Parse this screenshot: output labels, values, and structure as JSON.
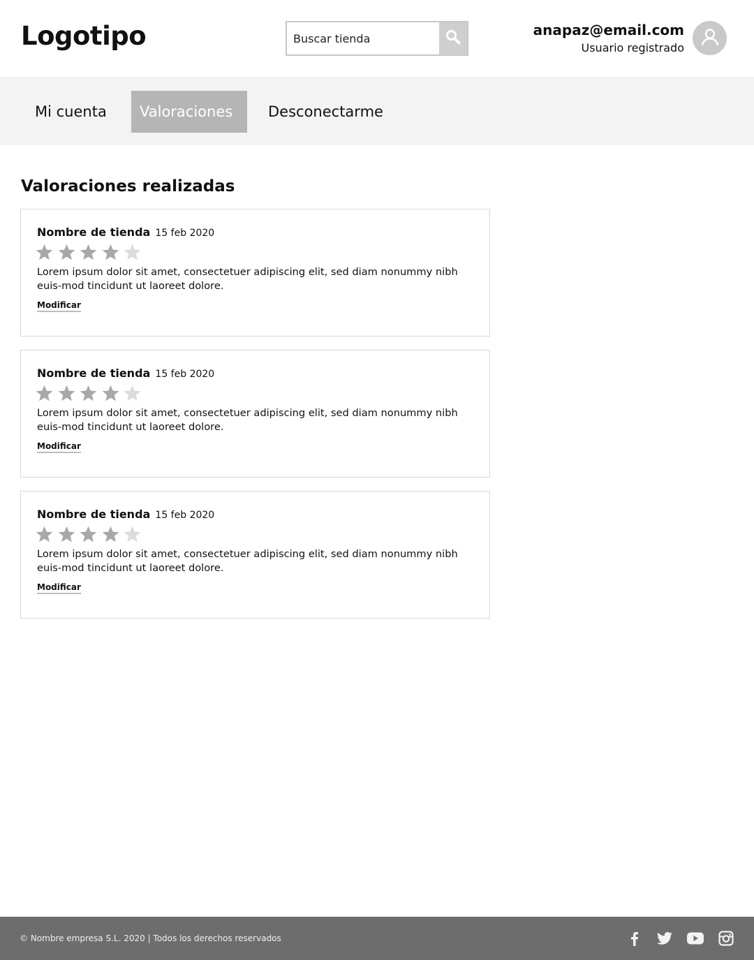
{
  "header": {
    "logo": "Logotipo",
    "search": {
      "placeholder": "Buscar tienda",
      "value": ""
    },
    "user": {
      "email": "anapaz@email.com",
      "role": "Usuario registrado"
    }
  },
  "nav": {
    "items": [
      {
        "label": "Mi cuenta",
        "active": false
      },
      {
        "label": "Valoraciones",
        "active": true
      },
      {
        "label": "Desconectarme",
        "active": false
      }
    ]
  },
  "main": {
    "title": "Valoraciones realizadas",
    "reviews": [
      {
        "store": "Nombre de tienda",
        "date": "15 feb 2020",
        "rating": 4,
        "max_rating": 5,
        "text": "Lorem ipsum dolor sit amet, consectetuer adipiscing elit, sed diam nonummy nibh euis-mod tincidunt ut laoreet dolore.",
        "action": "Modificar"
      },
      {
        "store": "Nombre de tienda",
        "date": "15 feb 2020",
        "rating": 4,
        "max_rating": 5,
        "text": "Lorem ipsum dolor sit amet, consectetuer adipiscing elit, sed diam nonummy nibh euis-mod tincidunt ut laoreet dolore.",
        "action": "Modificar"
      },
      {
        "store": "Nombre de tienda",
        "date": "15 feb 2020",
        "rating": 4,
        "max_rating": 5,
        "text": "Lorem ipsum dolor sit amet, consectetuer adipiscing elit, sed diam nonummy nibh euis-mod tincidunt ut laoreet dolore.",
        "action": "Modificar"
      }
    ]
  },
  "footer": {
    "copyright": "© Nombre empresa S.L. 2020 | Todos los derechos reservados",
    "social": [
      "facebook-icon",
      "twitter-icon",
      "youtube-icon",
      "instagram-icon"
    ]
  },
  "colors": {
    "nav_bg": "#f3f3f3",
    "nav_active": "#b5b5b5",
    "star_filled": "#a8a8a8",
    "star_empty": "#dcdcdc",
    "footer_bg": "#6d6d6d"
  }
}
